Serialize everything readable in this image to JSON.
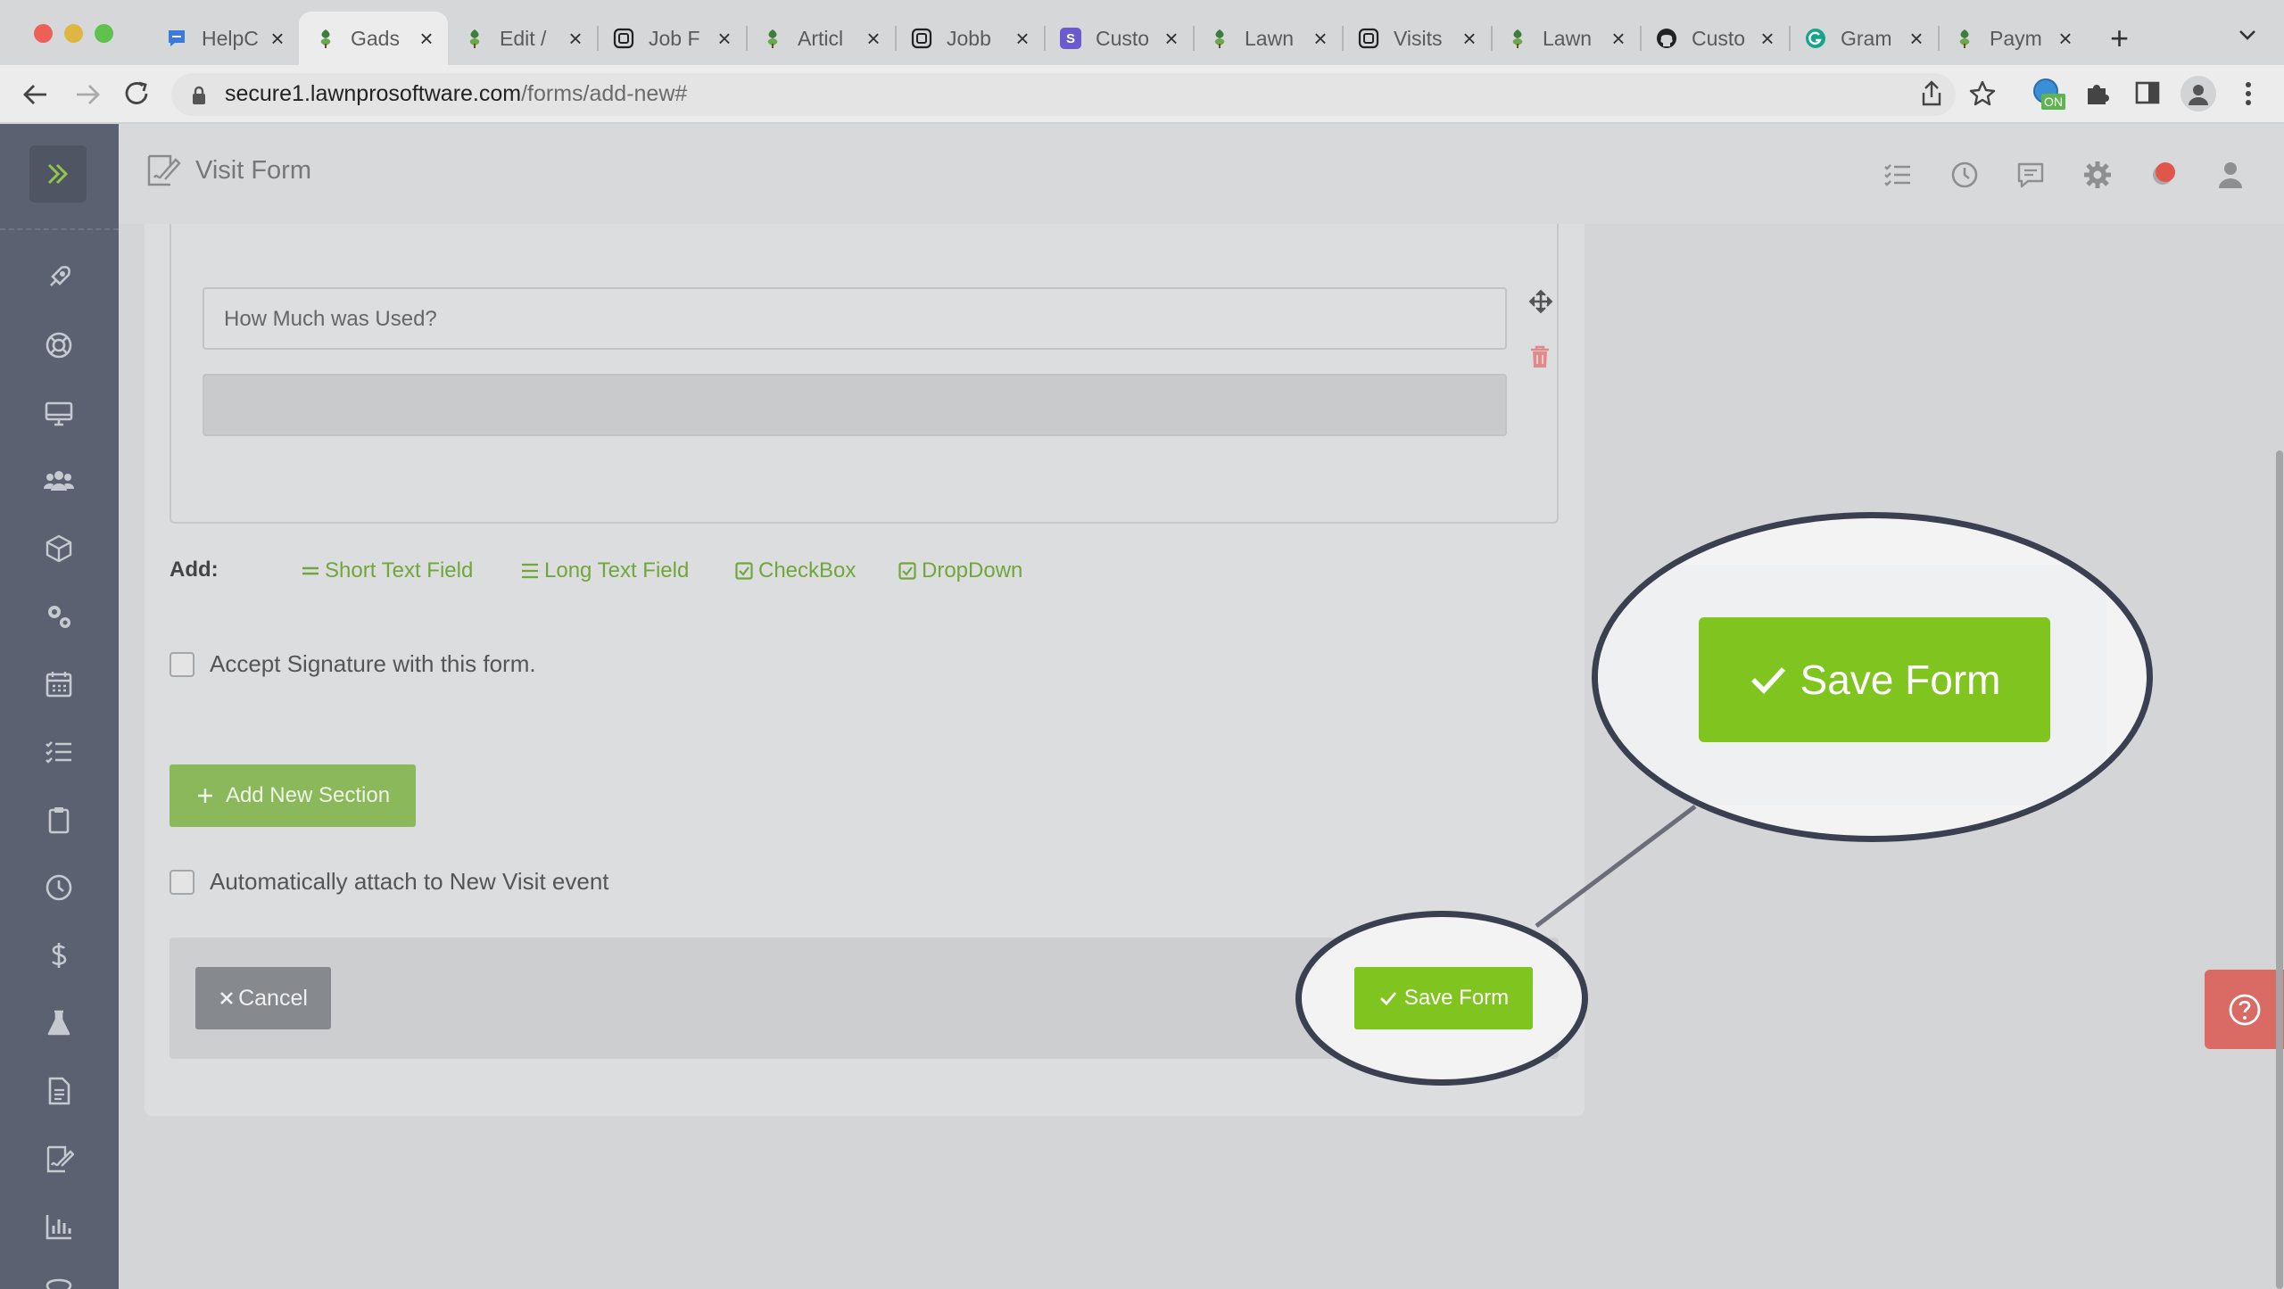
{
  "browser": {
    "tabs": [
      {
        "title": "HelpC",
        "favicon": "chat-favicon",
        "color": "#3d7bd8"
      },
      {
        "title": "Gads",
        "favicon": "lawnpro-favicon",
        "color": "#3f7d3c",
        "active": true
      },
      {
        "title": "Edit /",
        "favicon": "lawnpro-favicon",
        "color": "#3f7d3c"
      },
      {
        "title": "Job F",
        "favicon": "jobber-favicon",
        "color": "#222"
      },
      {
        "title": "Articl",
        "favicon": "lawnpro-favicon",
        "color": "#3f7d3c"
      },
      {
        "title": "Jobb",
        "favicon": "jobber-favicon",
        "color": "#222"
      },
      {
        "title": "Custo",
        "favicon": "s-favicon",
        "color": "#6a5acd",
        "letter": "S"
      },
      {
        "title": "Lawn",
        "favicon": "lawnpro-favicon",
        "color": "#3f7d3c"
      },
      {
        "title": "Visits",
        "favicon": "jobber-favicon",
        "color": "#222"
      },
      {
        "title": "Lawn",
        "favicon": "lawnpro-favicon",
        "color": "#3f7d3c"
      },
      {
        "title": "Custo",
        "favicon": "github-favicon",
        "color": "#222"
      },
      {
        "title": "Gram",
        "favicon": "grammarly-favicon",
        "color": "#15a58c"
      },
      {
        "title": "Paym",
        "favicon": "lawnpro-favicon",
        "color": "#3f7d3c"
      }
    ],
    "url_host": "secure1.lawnprosoftware.com",
    "url_path": "/forms/add-new#",
    "extension_badge": "ON"
  },
  "header": {
    "title": "Visit Form"
  },
  "form": {
    "question_text": "How Much was Used?",
    "answer_value": "",
    "add_label": "Add:",
    "add_options": {
      "short_text": "Short Text Field",
      "long_text": "Long Text Field",
      "checkbox": "CheckBox",
      "dropdown": "DropDown"
    },
    "accept_signature": "Accept Signature with this form.",
    "add_section": "Add New Section",
    "auto_attach": "Automatically attach to New Visit event",
    "cancel": "Cancel",
    "save": "Save Form"
  },
  "callout": {
    "save_zoomed": "Save Form"
  },
  "colors": {
    "accent_green": "#7fc41f",
    "link_green": "#71a63b",
    "sidebar": "#5b6170",
    "help_red": "#da6a64",
    "delete_red": "#e08a8a"
  }
}
